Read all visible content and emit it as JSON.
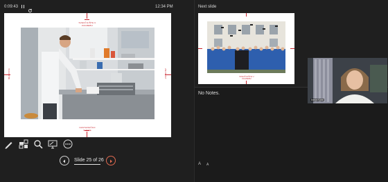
{
  "topbar": {
    "timer": "0:09:43",
    "clock": "12:34 PM",
    "next_slide_label": "Next slide"
  },
  "current_slide": {
    "top_text": "SVEUČILIŠTE U ZAGREBU",
    "bottom_text": "NASTAVNIČKO VIJEĆE",
    "left_text": "MEDICINA",
    "right_text": "ZNANOST"
  },
  "next_slide": {
    "bottom_text": "SVEUČILIŠTE U ZAGREBU"
  },
  "notes": {
    "text": "No Notes.",
    "font_larger": "A",
    "font_smaller": "A"
  },
  "video": {
    "name": "Ivana Kožić"
  },
  "navigation": {
    "slide_counter": "Slide 25 of 26"
  },
  "icons": [
    "pen-icon",
    "slides-grid-icon",
    "zoom-icon",
    "screen-icon",
    "more-icon",
    "prev-icon",
    "next-icon",
    "pause-icon",
    "reset-icon"
  ],
  "colors": {
    "accent": "#c8232c",
    "next_button": "#e06a50",
    "background": "#1f1f1f"
  }
}
